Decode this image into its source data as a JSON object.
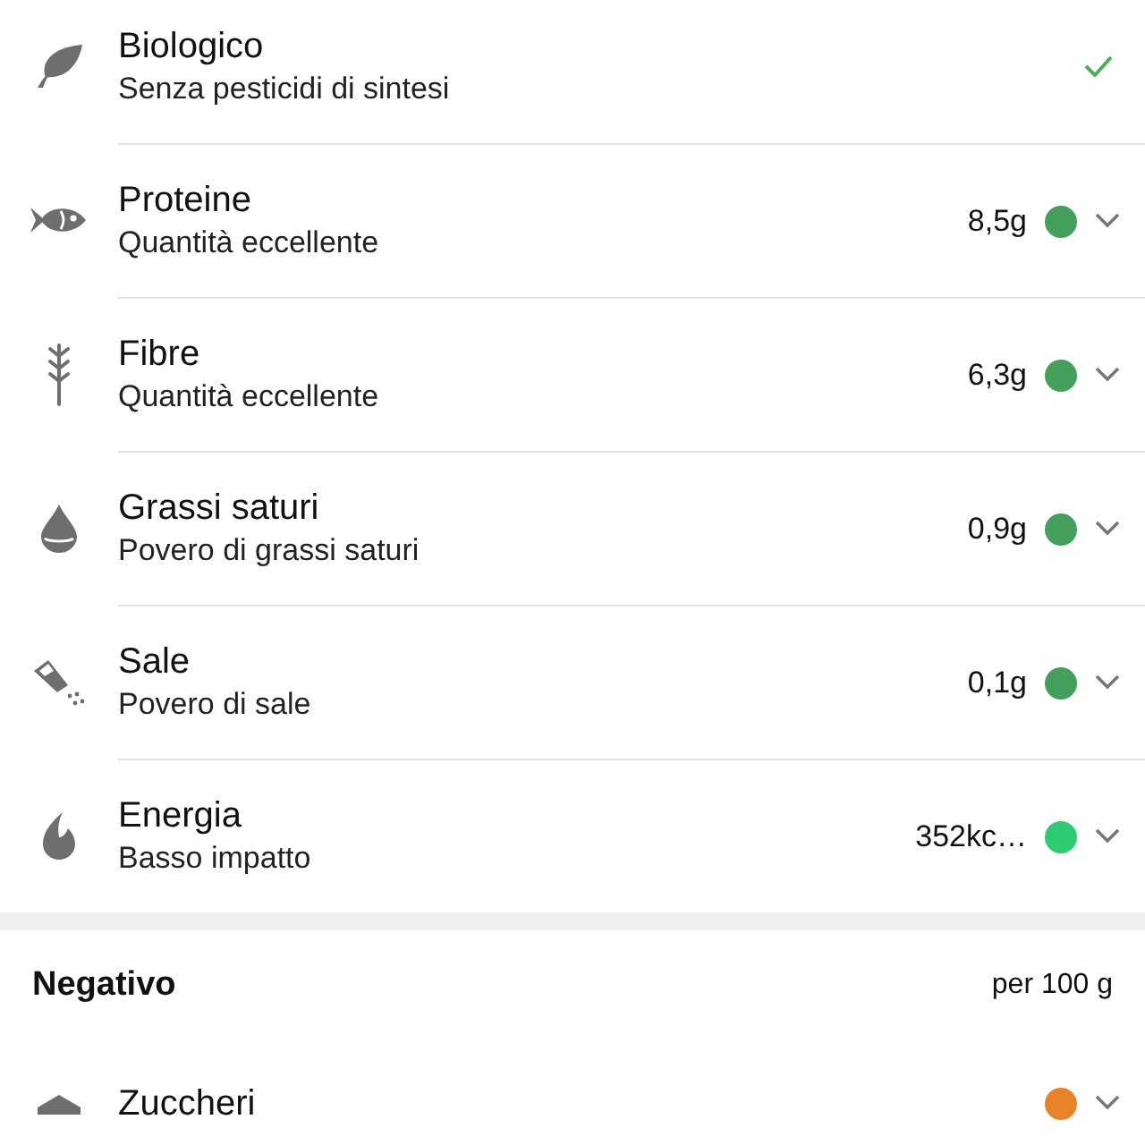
{
  "sections": [
    {
      "items": [
        {
          "title": "Biologico",
          "subtitle": "Senza pesticidi di sintesi",
          "kind": "check"
        },
        {
          "title": "Proteine",
          "subtitle": "Quantità eccellente",
          "kind": "value",
          "value": "8,5g",
          "color": "#43a05a"
        },
        {
          "title": "Fibre",
          "subtitle": "Quantità eccellente",
          "kind": "value",
          "value": "6,3g",
          "color": "#43a05a"
        },
        {
          "title": "Grassi saturi",
          "subtitle": "Povero di grassi saturi",
          "kind": "value",
          "value": "0,9g",
          "color": "#43a05a"
        },
        {
          "title": "Sale",
          "subtitle": "Povero di sale",
          "kind": "value",
          "value": "0,1g",
          "color": "#43a05a"
        },
        {
          "title": "Energia",
          "subtitle": "Basso impatto",
          "kind": "value",
          "value": "352kc…",
          "color": "#2ecc71"
        }
      ]
    },
    {
      "title": "Negativo",
      "unit": "per 100 g",
      "items": [
        {
          "title": "Zuccheri",
          "kind": "value",
          "color": "#e8832a"
        }
      ]
    }
  ]
}
